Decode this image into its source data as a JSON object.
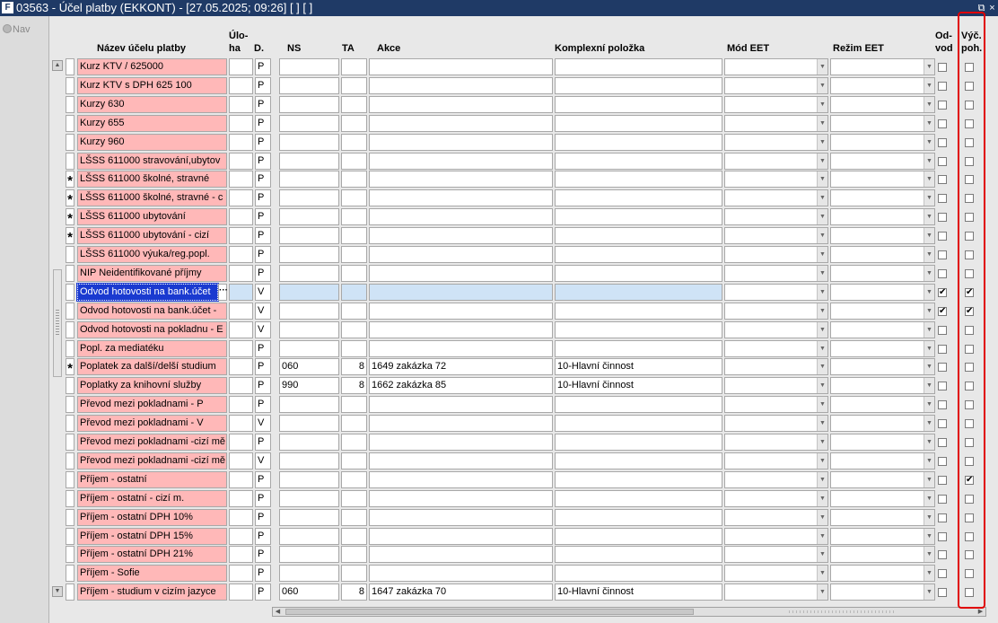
{
  "window": {
    "title": "03563 - Účel platby (EKKONT) - [27.05.2025; 09:26]  [ ]  [ ]",
    "restore_glyph": "⧉",
    "close_glyph": "×"
  },
  "nav": {
    "label": "Nav"
  },
  "columns": {
    "nazev": "Název účelu platby",
    "uloha_1": "Úlo-",
    "uloha_2": "ha",
    "d": "D.",
    "ns": "NS",
    "ta": "TA",
    "akce": "Akce",
    "komplexni": "Komplexní položka",
    "mod_eet": "Mód EET",
    "rezim_eet": "Režim EET",
    "odvod_1": "Od-",
    "odvod_2": "vod",
    "vyc_1": "Výč.",
    "vyc_2": "poh."
  },
  "rows": [
    {
      "star": "",
      "name": "Kurz KTV / 625000",
      "uloha": "",
      "d": "P",
      "ns": "",
      "ta": "",
      "akce": "",
      "komplex": "",
      "odvod": false,
      "vyc": false
    },
    {
      "star": "",
      "name": "Kurz KTV s DPH 625 100",
      "uloha": "",
      "d": "P",
      "ns": "",
      "ta": "",
      "akce": "",
      "komplex": "",
      "odvod": false,
      "vyc": false
    },
    {
      "star": "",
      "name": "Kurzy 630",
      "uloha": "",
      "d": "P",
      "ns": "",
      "ta": "",
      "akce": "",
      "komplex": "",
      "odvod": false,
      "vyc": false
    },
    {
      "star": "",
      "name": "Kurzy 655",
      "uloha": "",
      "d": "P",
      "ns": "",
      "ta": "",
      "akce": "",
      "komplex": "",
      "odvod": false,
      "vyc": false
    },
    {
      "star": "",
      "name": "Kurzy 960",
      "uloha": "",
      "d": "P",
      "ns": "",
      "ta": "",
      "akce": "",
      "komplex": "",
      "odvod": false,
      "vyc": false
    },
    {
      "star": "",
      "name": "LŠSS 611000 stravování,ubytov",
      "uloha": "",
      "d": "P",
      "ns": "",
      "ta": "",
      "akce": "",
      "komplex": "",
      "odvod": false,
      "vyc": false
    },
    {
      "star": "*",
      "name": "LŠSS 611000 školné, stravné",
      "uloha": "",
      "d": "P",
      "ns": "",
      "ta": "",
      "akce": "",
      "komplex": "",
      "odvod": false,
      "vyc": false
    },
    {
      "star": "*",
      "name": "LŠSS 611000 školné, stravné - c",
      "uloha": "",
      "d": "P",
      "ns": "",
      "ta": "",
      "akce": "",
      "komplex": "",
      "odvod": false,
      "vyc": false
    },
    {
      "star": "*",
      "name": "LŠSS 611000 ubytování",
      "uloha": "",
      "d": "P",
      "ns": "",
      "ta": "",
      "akce": "",
      "komplex": "",
      "odvod": false,
      "vyc": false
    },
    {
      "star": "*",
      "name": "LŠSS 611000 ubytování - cizí",
      "uloha": "",
      "d": "P",
      "ns": "",
      "ta": "",
      "akce": "",
      "komplex": "",
      "odvod": false,
      "vyc": false
    },
    {
      "star": "",
      "name": "LŠSS 611000 výuka/reg.popl.",
      "uloha": "",
      "d": "P",
      "ns": "",
      "ta": "",
      "akce": "",
      "komplex": "",
      "odvod": false,
      "vyc": false
    },
    {
      "star": "",
      "name": "NIP Neidentifikované příjmy",
      "uloha": "",
      "d": "P",
      "ns": "",
      "ta": "",
      "akce": "",
      "komplex": "",
      "odvod": false,
      "vyc": false
    },
    {
      "star": "",
      "name": "Odvod hotovosti na bank.účet",
      "uloha": "",
      "d": "V",
      "ns": "",
      "ta": "",
      "akce": "",
      "komplex": "",
      "odvod": true,
      "vyc": true,
      "selected": true
    },
    {
      "star": "",
      "name": "Odvod hotovosti na bank.účet -",
      "uloha": "",
      "d": "V",
      "ns": "",
      "ta": "",
      "akce": "",
      "komplex": "",
      "odvod": true,
      "vyc": true
    },
    {
      "star": "",
      "name": "Odvod hotovosti na pokladnu - E",
      "uloha": "",
      "d": "V",
      "ns": "",
      "ta": "",
      "akce": "",
      "komplex": "",
      "odvod": false,
      "vyc": false
    },
    {
      "star": "",
      "name": "Popl. za mediatéku",
      "uloha": "",
      "d": "P",
      "ns": "",
      "ta": "",
      "akce": "",
      "komplex": "",
      "odvod": false,
      "vyc": false
    },
    {
      "star": "*",
      "name": "Poplatek za další/delší studium",
      "uloha": "",
      "d": "P",
      "ns": "060",
      "ta": "8",
      "akce": "1649 zakázka 72",
      "komplex": "10-Hlavní činnost",
      "odvod": false,
      "vyc": false
    },
    {
      "star": "",
      "name": "Poplatky za knihovní služby",
      "uloha": "",
      "d": "P",
      "ns": "990",
      "ta": "8",
      "akce": "1662 zakázka 85",
      "komplex": "10-Hlavní činnost",
      "odvod": false,
      "vyc": false
    },
    {
      "star": "",
      "name": "Převod mezi pokladnami - P",
      "uloha": "",
      "d": "P",
      "ns": "",
      "ta": "",
      "akce": "",
      "komplex": "",
      "odvod": false,
      "vyc": false
    },
    {
      "star": "",
      "name": "Převod mezi pokladnami - V",
      "uloha": "",
      "d": "V",
      "ns": "",
      "ta": "",
      "akce": "",
      "komplex": "",
      "odvod": false,
      "vyc": false
    },
    {
      "star": "",
      "name": "Převod mezi pokladnami -cizí mě",
      "uloha": "",
      "d": "P",
      "ns": "",
      "ta": "",
      "akce": "",
      "komplex": "",
      "odvod": false,
      "vyc": false
    },
    {
      "star": "",
      "name": "Převod mezi pokladnami -cizí mě",
      "uloha": "",
      "d": "V",
      "ns": "",
      "ta": "",
      "akce": "",
      "komplex": "",
      "odvod": false,
      "vyc": false
    },
    {
      "star": "",
      "name": "Příjem - ostatní",
      "uloha": "",
      "d": "P",
      "ns": "",
      "ta": "",
      "akce": "",
      "komplex": "",
      "odvod": false,
      "vyc": true
    },
    {
      "star": "",
      "name": "Příjem - ostatní - cizí m.",
      "uloha": "",
      "d": "P",
      "ns": "",
      "ta": "",
      "akce": "",
      "komplex": "",
      "odvod": false,
      "vyc": false
    },
    {
      "star": "",
      "name": "Příjem - ostatní DPH 10%",
      "uloha": "",
      "d": "P",
      "ns": "",
      "ta": "",
      "akce": "",
      "komplex": "",
      "odvod": false,
      "vyc": false
    },
    {
      "star": "",
      "name": "Příjem - ostatní DPH 15%",
      "uloha": "",
      "d": "P",
      "ns": "",
      "ta": "",
      "akce": "",
      "komplex": "",
      "odvod": false,
      "vyc": false
    },
    {
      "star": "",
      "name": "Příjem - ostatní DPH 21%",
      "uloha": "",
      "d": "P",
      "ns": "",
      "ta": "",
      "akce": "",
      "komplex": "",
      "odvod": false,
      "vyc": false
    },
    {
      "star": "",
      "name": "Příjem - Sofie",
      "uloha": "",
      "d": "P",
      "ns": "",
      "ta": "",
      "akce": "",
      "komplex": "",
      "odvod": false,
      "vyc": false
    },
    {
      "star": "",
      "name": "Příjem - studium v cizím jazyce",
      "uloha": "",
      "d": "P",
      "ns": "060",
      "ta": "8",
      "akce": "1647 zakázka 70",
      "komplex": "10-Hlavní činnost",
      "odvod": false,
      "vyc": false
    }
  ],
  "glyphs": {
    "check": "✔",
    "dropdown": "▼",
    "ellipsis": "···",
    "up": "▲",
    "down": "▼",
    "left": "◀",
    "right": "▶"
  }
}
